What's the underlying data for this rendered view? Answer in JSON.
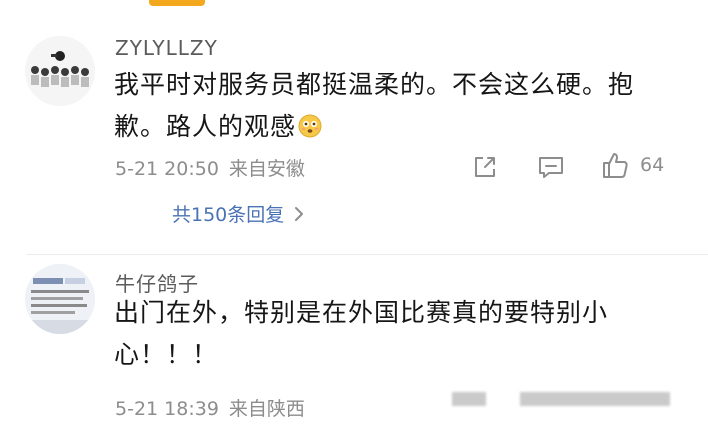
{
  "comments": [
    {
      "username": "ZYLYLLZY",
      "content_line1": "我平时对服务员都挺温柔的。不会这么硬。抱",
      "content_line2": "歉。路人的观感",
      "emoji": "flushed-face-emoji",
      "date": "5-21 20:50",
      "location": "来自安徽",
      "like_count": "64",
      "replies_label": "共150条回复",
      "icons": [
        "share-icon",
        "comment-icon",
        "thumbs-up-icon",
        "chevron-right-icon"
      ]
    },
    {
      "username": "牛仔鸽子",
      "content_line1": "出门在外，特别是在外国比赛真的要特别小",
      "content_line2": "心！！！",
      "date": "5-21 18:39",
      "location": "来自陕西"
    }
  ],
  "colors": {
    "accent": "#f3a81e",
    "link": "#4a73b6",
    "meta": "#8d8d8d",
    "text": "#161616"
  }
}
